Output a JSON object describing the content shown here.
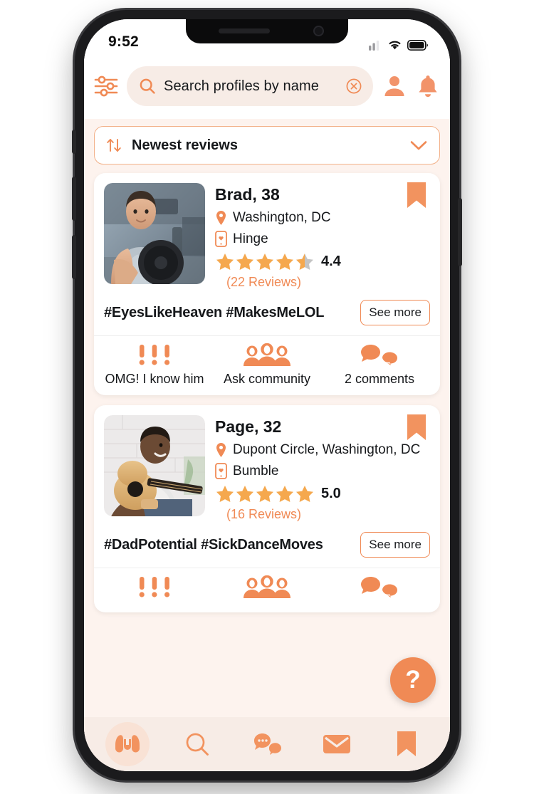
{
  "status_bar": {
    "time": "9:52",
    "signal": "signal-bars",
    "wifi": "wifi",
    "battery": "battery-full"
  },
  "header": {
    "filter_icon": "filter-sliders-icon",
    "search": {
      "placeholder": "Search profiles by name",
      "value": "Search profiles by name",
      "search_icon": "search-icon",
      "clear_icon": "clear-circle-icon"
    },
    "profile_icon": "person-icon",
    "notifications_icon": "bell-icon"
  },
  "sort": {
    "label": "Newest reviews",
    "sort_icon": "sort-arrows-icon",
    "chevron": "chevron-down-icon"
  },
  "cards": [
    {
      "name": "Brad, 38",
      "location": "Washington, DC",
      "app": "Hinge",
      "rating": "4.4",
      "stars_filled": 4.5,
      "reviews": "(22 Reviews)",
      "tags": "#EyesLikeHeaven #MakesMeLOL",
      "see_more": "See more",
      "photo_alt": "man-lifting-dumbbell-in-gym",
      "bookmark_icon": "bookmark-icon",
      "location_icon": "map-pin-icon",
      "app_icon": "dating-app-phone-icon",
      "actions": [
        {
          "icon": "exclamation-marks-icon",
          "label": "OMG! I know him"
        },
        {
          "icon": "community-group-icon",
          "label": "Ask community"
        },
        {
          "icon": "comments-bubbles-icon",
          "label": "2 comments"
        }
      ]
    },
    {
      "name": "Page, 32",
      "location": "Dupont Circle, Washington, DC",
      "app": "Bumble",
      "rating": "5.0",
      "stars_filled": 5,
      "reviews": "(16 Reviews)",
      "tags": "#DadPotential #SickDanceMoves",
      "see_more": "See more",
      "photo_alt": "man-playing-acoustic-guitar",
      "bookmark_icon": "bookmark-icon",
      "location_icon": "map-pin-icon",
      "app_icon": "dating-app-phone-icon",
      "actions": [
        {
          "icon": "exclamation-marks-icon",
          "label": ""
        },
        {
          "icon": "community-group-icon",
          "label": ""
        },
        {
          "icon": "comments-bubbles-icon",
          "label": ""
        }
      ]
    }
  ],
  "help_fab": {
    "icon": "question-mark-icon",
    "label": "?"
  },
  "bottom_nav": [
    {
      "icon": "binoculars-icon",
      "active": true
    },
    {
      "icon": "search-icon",
      "active": false
    },
    {
      "icon": "chat-bubbles-icon",
      "active": false
    },
    {
      "icon": "envelope-icon",
      "active": false
    },
    {
      "icon": "bookmark-icon",
      "active": false
    }
  ],
  "colors": {
    "accent": "#f08a55",
    "star": "#f5a84e",
    "star_empty": "#c4c4c4",
    "nav_bg": "#f7ece6",
    "screen_bg": "#fdf3ee"
  }
}
